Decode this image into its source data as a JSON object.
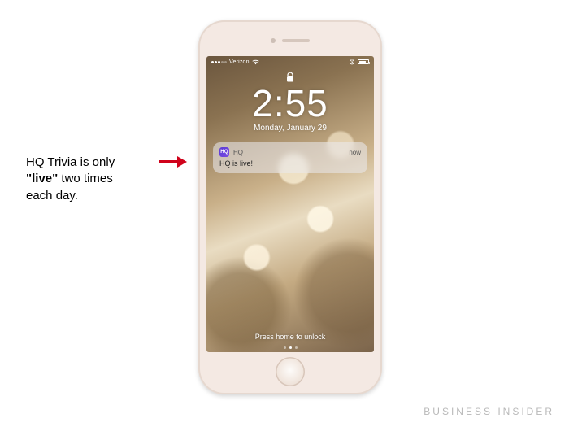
{
  "caption": {
    "line1": "HQ Trivia is only",
    "bold": "\"live\"",
    "line2_tail": " two times",
    "line3": "each day."
  },
  "statusbar": {
    "carrier": "Verizon",
    "network_icon": "wifi",
    "alarm_icon": "alarm",
    "battery_pct": 70
  },
  "lockscreen": {
    "time": "2:55",
    "date": "Monday, January 29",
    "unlock_hint": "Press home to unlock"
  },
  "notification": {
    "app_name": "HQ",
    "app_icon_text": "HQ",
    "timestamp": "now",
    "body": "HQ is live!"
  },
  "watermark": "BUSINESS INSIDER"
}
